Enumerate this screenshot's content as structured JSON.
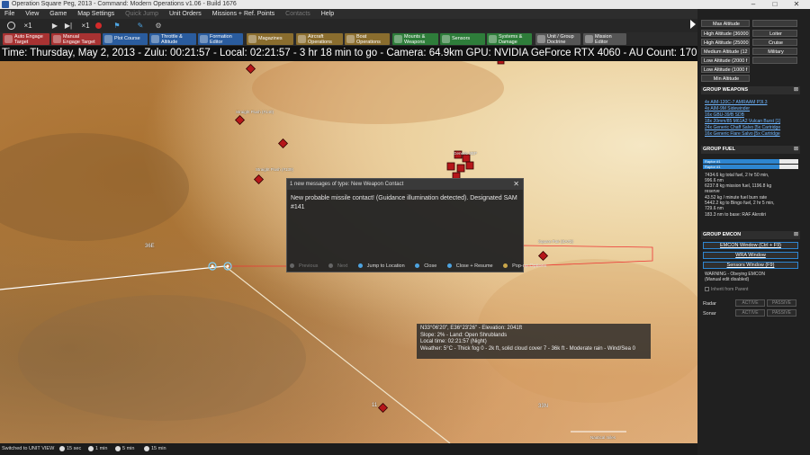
{
  "window": {
    "title": "Operation Square Peg, 2013 - Command: Modern Operations v1.06 - Build 1676",
    "minimize": "–",
    "maximize": "□",
    "close": "✕"
  },
  "menu": [
    "File",
    "View",
    "Game",
    "Map Settings",
    "Quick Jump",
    "Unit Orders",
    "Missions + Ref. Points",
    "Contacts",
    "Help"
  ],
  "menu_disabled": [
    "Quick Jump",
    "Contacts"
  ],
  "toolbar1": {
    "speed_left": "×1",
    "speed_right": "×1"
  },
  "toolbar2": [
    {
      "label": "Auto Engage\nTarget",
      "color": "#a83232",
      "icon": "crosshair-icon"
    },
    {
      "label": "Manual\nEngage Target",
      "color": "#a83232",
      "icon": "target-icon"
    },
    {
      "label": "Plot Course",
      "color": "#2a5c9e",
      "icon": "course-icon"
    },
    {
      "label": "Throttle &\nAltitude",
      "color": "#2a5c9e",
      "icon": "throttle-icon"
    },
    {
      "label": "Formation\nEditor",
      "color": "#2a5c9e",
      "icon": "formation-icon"
    },
    {
      "label": "Magazines",
      "color": "#8a6d2e",
      "icon": "magazine-icon"
    },
    {
      "label": "Aircraft\nOperations",
      "color": "#8a6d2e",
      "icon": "aircraft-icon"
    },
    {
      "label": "Boat\nOperations",
      "color": "#8a6d2e",
      "icon": "boat-icon"
    },
    {
      "label": "Mounts &\nWeapons",
      "color": "#2e7d3a",
      "icon": "mounts-icon"
    },
    {
      "label": "Sensors",
      "color": "#2e7d3a",
      "icon": "sensor-icon"
    },
    {
      "label": "Systems &\nDamage",
      "color": "#2e7d3a",
      "icon": "systems-icon"
    },
    {
      "label": "Unit / Group\nDoctrine",
      "color": "#555555",
      "icon": "doctrine-icon"
    },
    {
      "label": "Mission\nEditor",
      "color": "#555555",
      "icon": "mission-icon"
    }
  ],
  "status_line": "Time: Thursday, May 2, 2013 - Zulu: 00:21:57 - Local: 02:21:57 - 3 hr 18 min to go - Camera: 64.9km GPU: NVIDIA GeForce RTX 4060 - AU Count: 170 - Pulse Time: 7ms",
  "map": {
    "unit_labels": [
      "Straight Flush (#140)",
      "Straight Flush (#139)",
      "Generic SEP",
      "Square Pair (SA#2)"
    ],
    "numbers": [
      "36E",
      "11",
      "33N"
    ],
    "scale_label": "Nautical miles"
  },
  "message": {
    "header": "1 new messages of type: New Weapon Contact",
    "body": "New probable missile contact! (Guidance illumination detected). Designated SAM #141",
    "buttons": {
      "previous": "Previous",
      "next": "Next",
      "jump": "Jump to Location",
      "close": "Close",
      "close_resume": "Close + Resume",
      "popup": "Pop-up Options"
    }
  },
  "info": {
    "line1": "N33°06'20\", E36°23'26\" - Elevation: 2041ft",
    "line2": "Slope: 2%  - Land: Open Shrublands",
    "line3": "Local time: 02:21:57 (Night)",
    "line4": "Weather: 5°C - Thick fog 0 - 2k ft, solid cloud cover 7 - 36k ft - Moderate rain - Wind/Sea 0"
  },
  "right_panel": {
    "altitude_left": [
      "Max Altitude",
      "High Altitude (36000",
      "High Altitude (25000",
      "Medium Altitude (12",
      "Low Altitude (2000 f",
      "Low Altitude (1000 f",
      "Min Altitude"
    ],
    "altitude_right": [
      "",
      "Loiter",
      "Cruise",
      "Military",
      ""
    ],
    "weapons_header": "GROUP WEAPONS",
    "weapons": [
      "4x AIM-120C-7 AMRAAM P3I.3",
      "4x AIM-9M Sidewinder",
      "16x GBU-39/B SDB",
      "18x 20mm/85 M61A2 Vulcan Burst [1]",
      "24x Generic Chaff Salvo [5x Cartridge",
      "16x Generic Flare Salvo [5x Cartridge"
    ],
    "fuel_header": "GROUP FUEL",
    "fuel_bars": [
      {
        "label": "Raptor #1",
        "fraction": 0.8
      },
      {
        "label": "Raptor #1",
        "fraction": 0.8
      }
    ],
    "fuel_text": [
      "7434.6 kg total fuel, 2 hr 50 min,",
      "996.6 nm",
      "6237.8 kg mission fuel, 1196.8 kg",
      "reserve",
      "43.52 kg / minute fuel burn rate",
      "5442.2 kg to Bingo fuel, 2 hr 5 min,",
      "729.6 nm",
      "183.3 nm to base: RAF Akrotiri"
    ],
    "emcon_header": "GROUP EMCON",
    "emcon_buttons": [
      "EMCON Window (Ctrl + F9)",
      "WRA Window",
      "Sensors Window (F9)"
    ],
    "emcon_text": [
      "WARNING - Obeying EMCON",
      "(Manual edit disabled)"
    ],
    "inherit_label": "Inherit from Parent",
    "emcon_rows": [
      {
        "label": "Radar",
        "active": "ACTIVE",
        "passive": "PASSIVE"
      },
      {
        "label": "Sonar",
        "active": "ACTIVE",
        "passive": "PASSIVE"
      }
    ],
    "collapse": "⊠"
  },
  "bottom": {
    "status": "Switched to UNIT VIEW",
    "times": [
      "15 sec",
      "1 min",
      "5 min",
      "15 min"
    ]
  }
}
